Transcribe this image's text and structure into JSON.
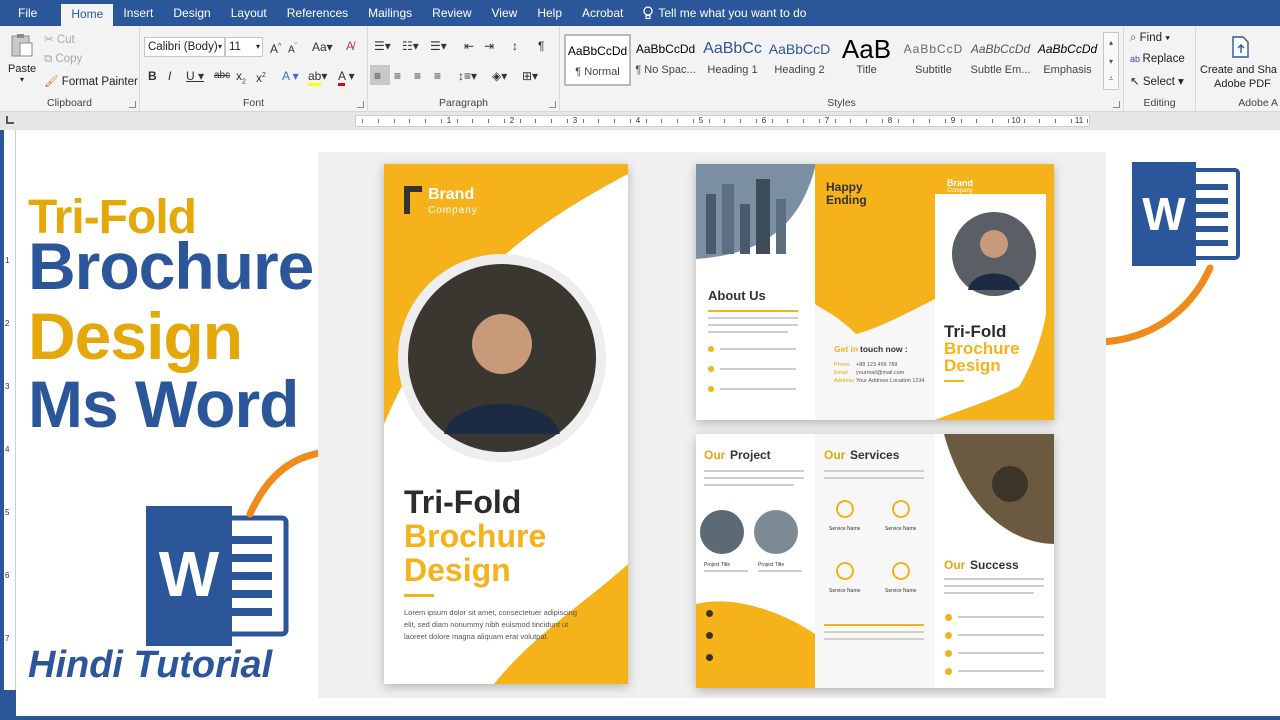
{
  "menu": {
    "items": [
      "File",
      "Home",
      "Insert",
      "Design",
      "Layout",
      "References",
      "Mailings",
      "Review",
      "View",
      "Help",
      "Acrobat"
    ],
    "tell_me": "Tell me what you want to do"
  },
  "clipboard": {
    "paste": "Paste",
    "cut": "Cut",
    "copy": "Copy",
    "format_painter": "Format Painter",
    "label": "Clipboard"
  },
  "font": {
    "family": "Calibri (Body)",
    "size": "11",
    "label": "Font"
  },
  "paragraph": {
    "label": "Paragraph"
  },
  "styles": {
    "label": "Styles",
    "items": [
      {
        "sample": "AaBbCcDd",
        "name": "¶ Normal"
      },
      {
        "sample": "AaBbCcDd",
        "name": "¶ No Spac..."
      },
      {
        "sample": "AaBbCc",
        "name": "Heading 1"
      },
      {
        "sample": "AaBbCcD",
        "name": "Heading 2"
      },
      {
        "sample": "AaB",
        "name": "Title"
      },
      {
        "sample": "AaBbCcD",
        "name": "Subtitle"
      },
      {
        "sample": "AaBbCcDd",
        "name": "Subtle Em..."
      },
      {
        "sample": "AaBbCcDd",
        "name": "Emphasis"
      }
    ]
  },
  "editing": {
    "find": "Find",
    "replace": "Replace",
    "select": "Select",
    "label": "Editing"
  },
  "adobe": {
    "create_line1": "Create and Sha",
    "create_line2": "Adobe PDF",
    "label": "Adobe A"
  },
  "ruler": {
    "numbers": [
      "1",
      "2",
      "3",
      "4",
      "5",
      "6",
      "7",
      "8",
      "9",
      "10",
      "11"
    ]
  },
  "vruler": {
    "numbers": [
      "1",
      "2",
      "3",
      "4",
      "5",
      "6",
      "7"
    ]
  },
  "thumb": {
    "line1": "Tri-Fold",
    "line2": "Brochure",
    "line3": "Design",
    "line4": "Ms Word",
    "footer": "Hindi Tutorial",
    "word_letter": "W"
  },
  "brochure": {
    "brand1": "Brand",
    "brand2": "Company",
    "cover_title1": "Tri-Fold",
    "cover_title2": "Brochure",
    "cover_title3": "Design",
    "cover_para1": "Lorem ipsum dolor sit amet, consectetuer adipiscing",
    "cover_para2": "elit, sed diam nonummy nibh euismod tincidunt ut",
    "cover_para3": "laoreet dolore magna aliquam erat volutpat.",
    "happy1": "Happy",
    "happy2": "Ending",
    "about": "About Us",
    "get_in": "Get in",
    "touch": "touch now :",
    "phone_lbl": "Phone",
    "phone": "+88 123 456 789",
    "email_lbl": "Email",
    "email": "yourmail@mail.com",
    "addr_lbl": "Address",
    "addr": "Your Address Location 1234",
    "out_title1": "Tri-Fold",
    "out_title2": "Brochure",
    "out_title3": "Design",
    "our1": "Our",
    "project": "Project",
    "services": "Services",
    "success": "Success",
    "project_title": "Project Title",
    "service_name": "Service Name"
  },
  "colors": {
    "word_blue": "#2b579a",
    "gold": "#f5b21b",
    "title_gold": "#e5a80b"
  }
}
